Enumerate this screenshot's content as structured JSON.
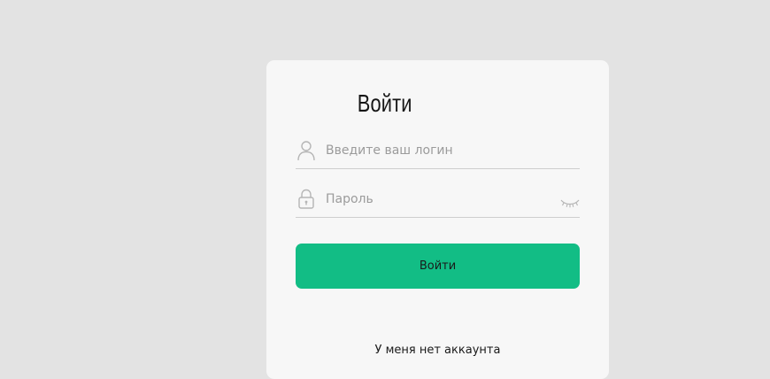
{
  "login_form": {
    "title": "Войти",
    "login_placeholder": "Введите ваш логин",
    "password_placeholder": "Пароль",
    "submit_label": "Войти",
    "no_account_link": "У меня нет аккаунта"
  },
  "icons": {
    "login": "user-icon",
    "password": "lock-icon",
    "toggle_visibility": "eye-closed-icon"
  },
  "colors": {
    "background": "#e3e3e3",
    "card": "#f7f7f7",
    "accent": "#12bd85"
  }
}
